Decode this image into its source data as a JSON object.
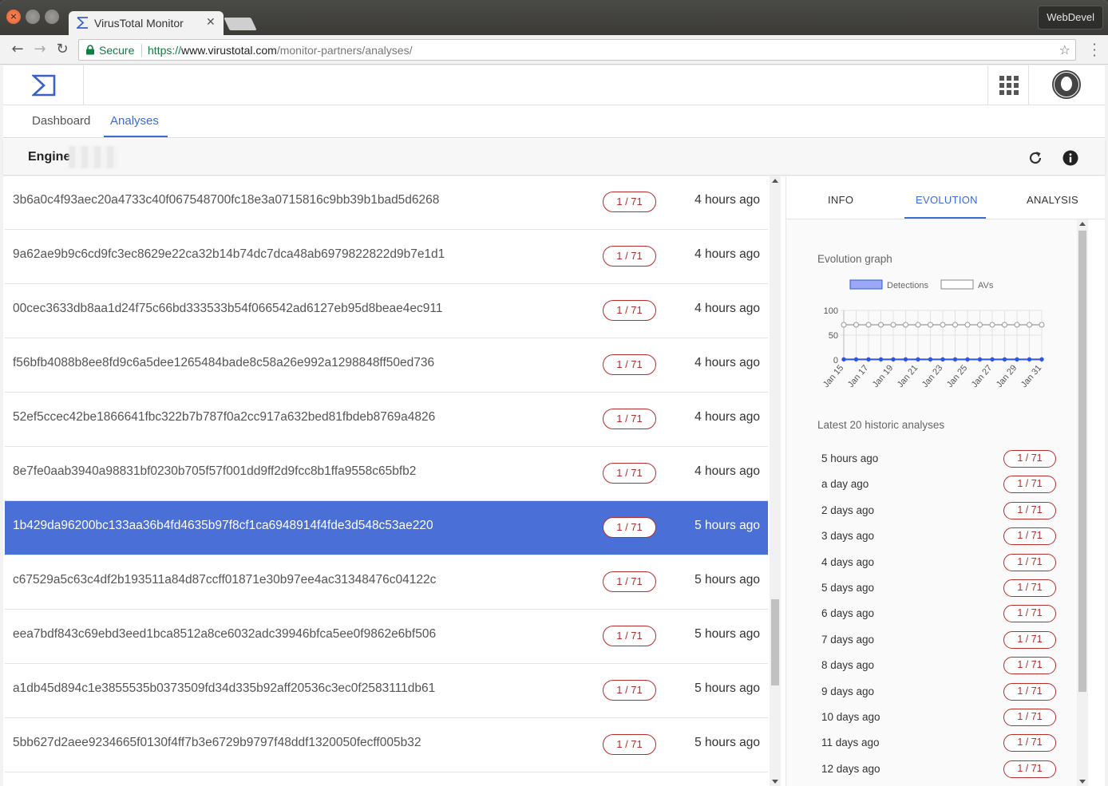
{
  "browser": {
    "tab_title": "VirusTotal Monitor",
    "profile_name": "WebDevel",
    "secure_label": "Secure",
    "url_scheme": "https://",
    "url_host": "www.virustotal.com",
    "url_path": "/monitor-partners/analyses/"
  },
  "nav": {
    "tabs": [
      {
        "label": "Dashboard"
      },
      {
        "label": "Analyses",
        "active": true
      }
    ]
  },
  "engine": {
    "label": "Engine:"
  },
  "analyses": [
    {
      "hash": "3b6a0c4f93aec20a4733c40f067548700fc18e3a0715816c9bb39b1bad5d6268",
      "detections": "1 / 71",
      "time": "4 hours ago"
    },
    {
      "hash": "9a62ae9b9c6cd9fc3ec8629e22ca32b14b74dc7dca48ab6979822822d9b7e1d1",
      "detections": "1 / 71",
      "time": "4 hours ago"
    },
    {
      "hash": "00cec3633db8aa1d24f75c66bd333533b54f066542ad6127eb95d8beae4ec911",
      "detections": "1 / 71",
      "time": "4 hours ago"
    },
    {
      "hash": "f56bfb4088b8ee8fd9c6a5dee1265484bade8c58a26e992a1298848ff50ed736",
      "detections": "1 / 71",
      "time": "4 hours ago"
    },
    {
      "hash": "52ef5ccec42be1866641fbc322b7b787f0a2cc917a632bed81fbdeb8769a4826",
      "detections": "1 / 71",
      "time": "4 hours ago"
    },
    {
      "hash": "8e7fe0aab3940a98831bf0230b705f57f001dd9ff2d9fcc8b1ffa9558c65bfb2",
      "detections": "1 / 71",
      "time": "4 hours ago"
    },
    {
      "hash": "1b429da96200bc133aa36b4fd4635b97f8cf1ca6948914f4fde3d548c53ae220",
      "detections": "1 / 71",
      "time": "5 hours ago",
      "selected": true
    },
    {
      "hash": "c67529a5c63c4df2b193511a84d87ccff01871e30b97ee4ac31348476c04122c",
      "detections": "1 / 71",
      "time": "5 hours ago"
    },
    {
      "hash": "eea7bdf843c69ebd3eed1bca8512a8ce6032adc39946bfca5ee0f9862e6bf506",
      "detections": "1 / 71",
      "time": "5 hours ago"
    },
    {
      "hash": "a1db45d894c1e3855535b0373509fd34d335b92aff20536c3ec0f2583111db61",
      "detections": "1 / 71",
      "time": "5 hours ago"
    },
    {
      "hash": "5bb627d2aee9234665f0130f4ff7b3e6729b9797f48ddf1320050fecff005b32",
      "detections": "1 / 71",
      "time": "5 hours ago"
    }
  ],
  "panel": {
    "tabs": [
      {
        "label": "INFO"
      },
      {
        "label": "EVOLUTION",
        "active": true
      },
      {
        "label": "ANALYSIS"
      }
    ],
    "evolution_title": "Evolution graph",
    "history_title": "Latest 20 historic analyses",
    "history": [
      {
        "time": "5 hours ago",
        "detections": "1 / 71"
      },
      {
        "time": "a day ago",
        "detections": "1 / 71"
      },
      {
        "time": "2 days ago",
        "detections": "1 / 71"
      },
      {
        "time": "3 days ago",
        "detections": "1 / 71"
      },
      {
        "time": "4 days ago",
        "detections": "1 / 71"
      },
      {
        "time": "5 days ago",
        "detections": "1 / 71"
      },
      {
        "time": "6 days ago",
        "detections": "1 / 71"
      },
      {
        "time": "7 days ago",
        "detections": "1 / 71"
      },
      {
        "time": "8 days ago",
        "detections": "1 / 71"
      },
      {
        "time": "9 days ago",
        "detections": "1 / 71"
      },
      {
        "time": "10 days ago",
        "detections": "1 / 71"
      },
      {
        "time": "11 days ago",
        "detections": "1 / 71"
      },
      {
        "time": "12 days ago",
        "detections": "1 / 71"
      }
    ]
  },
  "chart_data": {
    "type": "line",
    "title": "",
    "xlabel": "",
    "ylabel": "",
    "ylim": [
      0,
      100
    ],
    "yticks": [
      0,
      50,
      100
    ],
    "x": [
      "Jan 15",
      "Jan 16",
      "Jan 17",
      "Jan 18",
      "Jan 19",
      "Jan 20",
      "Jan 21",
      "Jan 22",
      "Jan 23",
      "Jan 24",
      "Jan 25",
      "Jan 26",
      "Jan 27",
      "Jan 28",
      "Jan 29",
      "Jan 30",
      "Jan 31"
    ],
    "xtick_labels": [
      "Jan 15",
      "Jan 17",
      "Jan 19",
      "Jan 21",
      "Jan 23",
      "Jan 25",
      "Jan 27",
      "Jan 29",
      "Jan 31"
    ],
    "legend_position": "top-center",
    "grid": true,
    "series": [
      {
        "name": "Detections",
        "color": "#3355dd",
        "fill": "#9aa8f5",
        "values": [
          1,
          1,
          1,
          1,
          1,
          1,
          1,
          1,
          1,
          1,
          1,
          1,
          1,
          1,
          1,
          1,
          1
        ]
      },
      {
        "name": "AVs",
        "color": "#999999",
        "fill": "#ffffff",
        "values": [
          71,
          71,
          71,
          71,
          71,
          71,
          71,
          71,
          71,
          71,
          71,
          71,
          71,
          71,
          71,
          71,
          71
        ]
      }
    ]
  },
  "colors": {
    "accent": "#3c6bd5",
    "selected_row": "#4a6fd6",
    "badge_red": "#b72c2c"
  }
}
